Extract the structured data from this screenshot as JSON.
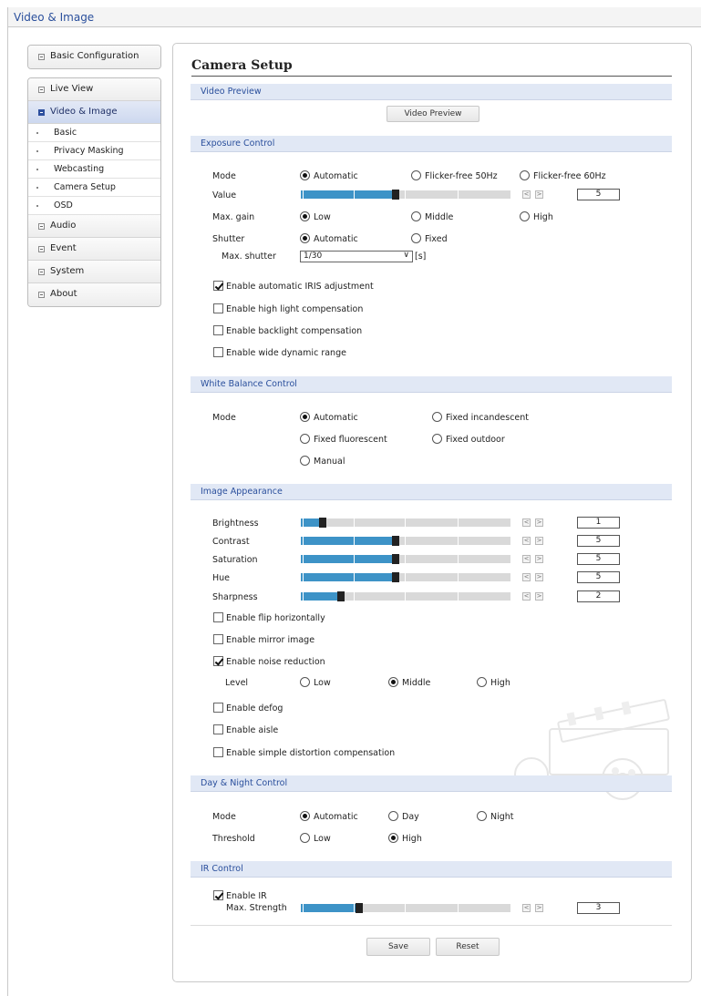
{
  "window": {
    "title": "Video & Image"
  },
  "sidebar": {
    "basic_configuration": "Basic Configuration",
    "items": [
      {
        "label": "Live View"
      },
      {
        "label": "Video & Image"
      }
    ],
    "subitems": [
      "Basic",
      "Privacy Masking",
      "Webcasting",
      "Camera Setup",
      "OSD"
    ],
    "items_after": [
      {
        "label": "Audio"
      },
      {
        "label": "Event"
      },
      {
        "label": "System"
      },
      {
        "label": "About"
      }
    ]
  },
  "page": {
    "title": "Camera Setup"
  },
  "video_preview": {
    "header": "Video Preview",
    "button": "Video Preview"
  },
  "exposure": {
    "header": "Exposure Control",
    "mode_label": "Mode",
    "mode_options": [
      "Automatic",
      "Flicker-free 50Hz",
      "Flicker-free 60Hz"
    ],
    "mode_selected": "Automatic",
    "value_label": "Value",
    "value": "5",
    "value_level": 5,
    "maxgain_label": "Max. gain",
    "maxgain_options": [
      "Low",
      "Middle",
      "High"
    ],
    "maxgain_selected": "Low",
    "shutter_label": "Shutter",
    "shutter_options": [
      "Automatic",
      "Fixed"
    ],
    "shutter_selected": "Automatic",
    "max_shutter_label": "Max. shutter",
    "max_shutter_value": "1/30",
    "max_shutter_unit": "[s]",
    "checkboxes": [
      {
        "label": "Enable automatic IRIS adjustment",
        "checked": true
      },
      {
        "label": "Enable high light compensation",
        "checked": false
      },
      {
        "label": "Enable backlight compensation",
        "checked": false
      },
      {
        "label": "Enable wide dynamic range",
        "checked": false
      }
    ]
  },
  "white_balance": {
    "header": "White Balance Control",
    "mode_label": "Mode",
    "options": [
      "Automatic",
      "Fixed incandescent",
      "Fixed fluorescent",
      "Fixed outdoor",
      "Manual"
    ],
    "selected": "Automatic"
  },
  "image_appearance": {
    "header": "Image Appearance",
    "sliders": [
      {
        "label": "Brightness",
        "value": "1",
        "level": 1
      },
      {
        "label": "Contrast",
        "value": "5",
        "level": 5
      },
      {
        "label": "Saturation",
        "value": "5",
        "level": 5
      },
      {
        "label": "Hue",
        "value": "5",
        "level": 5
      },
      {
        "label": "Sharpness",
        "value": "2",
        "level": 2
      }
    ],
    "flip": {
      "label": "Enable flip horizontally",
      "checked": false
    },
    "mirror": {
      "label": "Enable mirror image",
      "checked": false
    },
    "noise": {
      "label": "Enable noise reduction",
      "checked": true
    },
    "level_label": "Level",
    "level_options": [
      "Low",
      "Middle",
      "High"
    ],
    "level_selected": "Middle",
    "defog": {
      "label": "Enable defog",
      "checked": false
    },
    "aisle": {
      "label": "Enable aisle",
      "checked": false
    },
    "distortion": {
      "label": "Enable simple distortion compensation",
      "checked": false
    }
  },
  "day_night": {
    "header": "Day & Night Control",
    "mode_label": "Mode",
    "mode_options": [
      "Automatic",
      "Day",
      "Night"
    ],
    "mode_selected": "Automatic",
    "threshold_label": "Threshold",
    "threshold_options": [
      "Low",
      "High"
    ],
    "threshold_selected": "High"
  },
  "ir": {
    "header": "IR Control",
    "enable_label": "Enable IR",
    "enabled": true,
    "strength_label": "Max. Strength",
    "strength_value": "3",
    "strength_level": 3
  },
  "buttons": {
    "save": "Save",
    "reset": "Reset"
  },
  "colors": {
    "accent": "#2a4f9c",
    "slider_fill": "#3d93c7",
    "section_bg": "#e1e8f5"
  }
}
